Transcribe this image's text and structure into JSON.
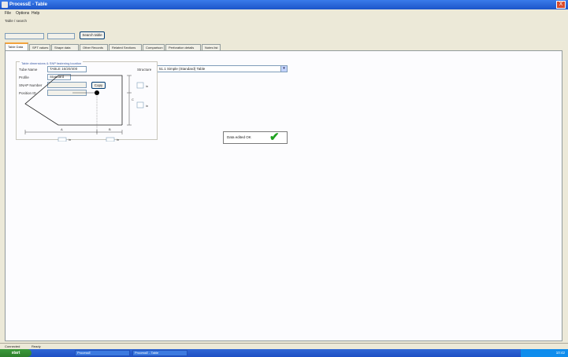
{
  "window": {
    "title": "ProcessE - Table",
    "close_glyph": "X"
  },
  "menu": {
    "items": [
      "File",
      "Options",
      "Help"
    ]
  },
  "topbar": {
    "label": "Table / search",
    "field1_value": "",
    "field2_value": "",
    "button_label": "Search table"
  },
  "tabs": [
    "Table Data",
    "SPT values",
    "Shape data",
    "Other Records",
    "Related Sections",
    "Comparison",
    "Perforation details",
    "Notes list"
  ],
  "form": {
    "tube_name_label": "Tube Name",
    "tube_name_value": "TABLE 16/20/400",
    "profile_label": "Profile",
    "profile_value": "Standard",
    "snap_number_label": "SNAP Number",
    "snap_number_value": "",
    "assign_button": "Copy",
    "position_label": "Position ID",
    "position_value": "",
    "structure_label": "Structure",
    "structure_value": "51.1 Simple (Standard) Table"
  },
  "diagram": {
    "legend": "Table dimensions & SNP fastening location",
    "dim_left": "A",
    "dim_mid": "B",
    "dim_right": "C",
    "unit_1": "in",
    "unit_2": "in",
    "unit_3": "in",
    "unit_4": "in"
  },
  "saved_button": {
    "label": "Data edited OK",
    "icon": "check-icon"
  },
  "statusbar": {
    "left": "Connected",
    "right": "Ready"
  },
  "taskbar": {
    "start": "start",
    "task1": "ProcessE",
    "task2": "ProcessE - Table",
    "clock": "10:42"
  }
}
